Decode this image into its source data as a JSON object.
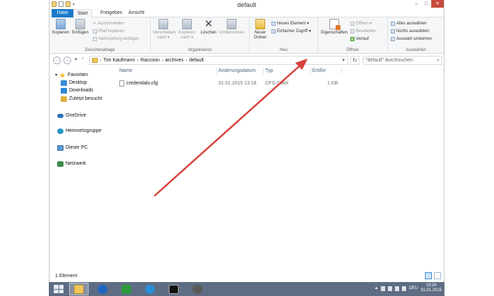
{
  "window": {
    "title": "default",
    "controls": {
      "minimize": "–",
      "maximize": "□",
      "close": "✕"
    }
  },
  "tabs": [
    {
      "label": "Datei"
    },
    {
      "label": "Start"
    },
    {
      "label": "Freigeben"
    },
    {
      "label": "Ansicht"
    }
  ],
  "ribbon": {
    "clipboard": {
      "label": "Zwischenablage",
      "copy": "Kopieren",
      "paste": "Einfügen",
      "cut": "Ausschneiden",
      "copy_path": "Pfad kopieren",
      "paste_shortcut": "Verknüpfung einfügen"
    },
    "organize": {
      "label": "Organisieren",
      "move_to": "Verschieben nach ▾",
      "copy_to": "Kopieren nach ▾",
      "delete": "Löschen",
      "rename": "Umbenennen"
    },
    "new": {
      "label": "Neu",
      "new_folder": "Neuer Ordner",
      "new_item": "Neues Element ▾",
      "easy_access": "Einfacher Zugriff ▾"
    },
    "open": {
      "label": "Öffnen",
      "properties": "Eigenschaften",
      "open": "Öffnen ▾",
      "edit": "Bearbeiten",
      "history": "Verlauf"
    },
    "select": {
      "label": "Auswählen",
      "select_all": "Alles auswählen",
      "select_none": "Nichts auswählen",
      "invert": "Auswahl umkehren"
    }
  },
  "address": {
    "crumbs": [
      "Tim Kaufmann",
      "Raccoon",
      "archives",
      "default"
    ],
    "search_placeholder": "\"default\" durchsuchen"
  },
  "navigation": {
    "favorites": "Favoriten",
    "desktop": "Desktop",
    "downloads": "Downloads",
    "recent": "Zuletzt besucht",
    "onedrive": "OneDrive",
    "homegroup": "Heimnetzgruppe",
    "this_pc": "Dieser PC",
    "network": "Netzwerk"
  },
  "columns": {
    "name": "Name",
    "modified": "Änderungsdatum",
    "type": "Typ",
    "size": "Größe"
  },
  "files": [
    {
      "name": "credentials.cfg",
      "modified": "31.01.2015 13:18",
      "type": "CFG-Datei",
      "size": "1 KB"
    }
  ],
  "status": {
    "count": "1 Element"
  },
  "taskbar": {
    "language": "DEU",
    "time": "13:24",
    "date": "31.01.2015"
  },
  "colors": {
    "file_tab": "#1979ca",
    "taskbar": "#5e6d83",
    "annotation_arrow": "#d9403a"
  }
}
